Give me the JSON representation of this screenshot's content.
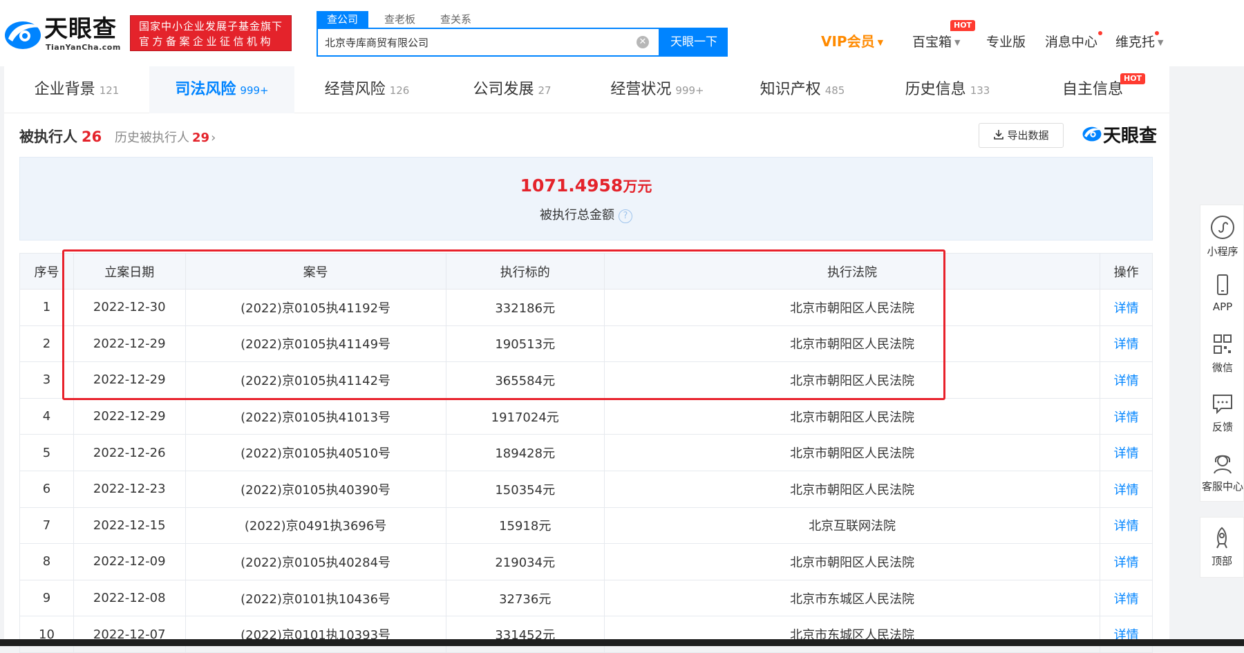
{
  "header": {
    "logo_name": "天眼查",
    "logo_domain": "TianYanCha.com",
    "banner_line1": "国家中小企业发展子基金旗下",
    "banner_line2": "官方备案企业征信机构",
    "search_tabs": [
      "查公司",
      "查老板",
      "查关系"
    ],
    "search_value": "北京寺库商贸有限公司",
    "search_button": "天眼一下",
    "vip": "VIP会员",
    "baibaoxiang": "百宝箱",
    "hot": "HOT",
    "pro": "专业版",
    "messages": "消息中心",
    "user": "维克托"
  },
  "tabs": [
    {
      "label": "企业背景",
      "count": "121"
    },
    {
      "label": "司法风险",
      "count": "999+"
    },
    {
      "label": "经营风险",
      "count": "126"
    },
    {
      "label": "公司发展",
      "count": "27"
    },
    {
      "label": "经营状况",
      "count": "999+"
    },
    {
      "label": "知识产权",
      "count": "485"
    },
    {
      "label": "历史信息",
      "count": "133"
    },
    {
      "label": "自主信息",
      "count": ""
    }
  ],
  "section": {
    "title": "被执行人",
    "count": "26",
    "history_label": "历史被执行人",
    "history_count": "29",
    "export": "导出数据",
    "brand": "天眼查"
  },
  "summary": {
    "amount": "1071.4958",
    "unit": "万元",
    "label": "被执行总金额"
  },
  "table": {
    "headers": [
      "序号",
      "立案日期",
      "案号",
      "执行标的",
      "执行法院",
      "操作"
    ],
    "rows": [
      [
        "1",
        "2022-12-30",
        "(2022)京0105执41192号",
        "332186元",
        "北京市朝阳区人民法院",
        "详情"
      ],
      [
        "2",
        "2022-12-29",
        "(2022)京0105执41149号",
        "190513元",
        "北京市朝阳区人民法院",
        "详情"
      ],
      [
        "3",
        "2022-12-29",
        "(2022)京0105执41142号",
        "365584元",
        "北京市朝阳区人民法院",
        "详情"
      ],
      [
        "4",
        "2022-12-29",
        "(2022)京0105执41013号",
        "1917024元",
        "北京市朝阳区人民法院",
        "详情"
      ],
      [
        "5",
        "2022-12-26",
        "(2022)京0105执40510号",
        "189428元",
        "北京市朝阳区人民法院",
        "详情"
      ],
      [
        "6",
        "2022-12-23",
        "(2022)京0105执40390号",
        "150354元",
        "北京市朝阳区人民法院",
        "详情"
      ],
      [
        "7",
        "2022-12-15",
        "(2022)京0491执3696号",
        "15918元",
        "北京互联网法院",
        "详情"
      ],
      [
        "8",
        "2022-12-09",
        "(2022)京0105执40284号",
        "219034元",
        "北京市朝阳区人民法院",
        "详情"
      ],
      [
        "9",
        "2022-12-08",
        "(2022)京0101执10436号",
        "32736元",
        "北京市东城区人民法院",
        "详情"
      ],
      [
        "10",
        "2022-12-07",
        "(2022)京0101执10393号",
        "331452元",
        "北京市东城区人民法院",
        "详情"
      ]
    ]
  },
  "sidebar": {
    "items": [
      "小程序",
      "APP",
      "微信",
      "反馈",
      "客服中心"
    ],
    "top": "顶部"
  },
  "colors": {
    "accent": "#0084ff",
    "danger": "#e4232b",
    "vip": "#ff8a00"
  }
}
